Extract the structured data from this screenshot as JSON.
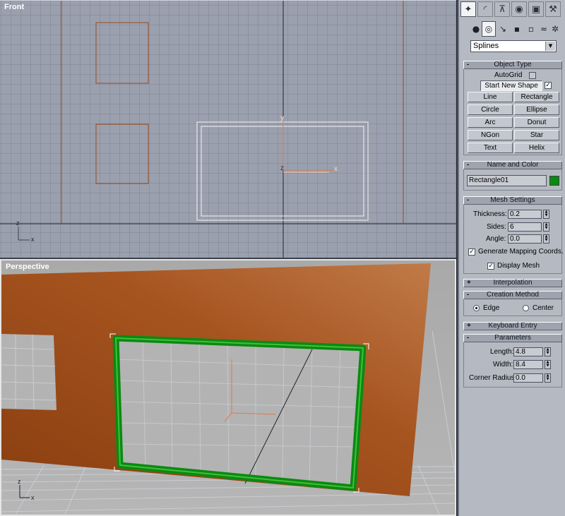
{
  "viewports": {
    "front": {
      "label": "Front"
    },
    "perspective": {
      "label": "Perspective"
    }
  },
  "panel": {
    "tabs": [
      "create-icon",
      "modify-icon",
      "hierarchy-icon",
      "motion-icon",
      "display-icon",
      "utilities-icon"
    ],
    "subcategories": [
      "geometry-icon",
      "shapes-icon",
      "lights-icon",
      "cameras-icon",
      "helpers-icon",
      "space-warps-icon",
      "systems-icon"
    ],
    "category_dropdown": "Splines",
    "object_type": {
      "title": "Object Type",
      "autogrid_label": "AutoGrid",
      "start_new_shape_label": "Start New Shape",
      "buttons": [
        "Line",
        "Rectangle",
        "Circle",
        "Ellipse",
        "Arc",
        "Donut",
        "NGon",
        "Star",
        "Text",
        "Helix"
      ]
    },
    "name_and_color": {
      "title": "Name and Color",
      "name_value": "Rectangle01",
      "color": "#0b8a10"
    },
    "mesh_settings": {
      "title": "Mesh Settings",
      "thickness_label": "Thickness:",
      "thickness_value": "0.2",
      "sides_label": "Sides:",
      "sides_value": "6",
      "angle_label": "Angle:",
      "angle_value": "0.0",
      "gen_mapping_label": "Generate Mapping Coords.",
      "display_mesh_label": "Display Mesh"
    },
    "interpolation": {
      "title": "Interpolation"
    },
    "creation_method": {
      "title": "Creation Method",
      "edge_label": "Edge",
      "center_label": "Center"
    },
    "keyboard_entry": {
      "title": "Keyboard Entry"
    },
    "parameters": {
      "title": "Parameters",
      "length_label": "Length:",
      "length_value": "4.8",
      "width_label": "Width:",
      "width_value": "8.4",
      "corner_radius_label": "Corner Radius:",
      "corner_radius_value": "0.0"
    }
  },
  "axis_labels": {
    "x": "x",
    "y": "y",
    "z": "z"
  },
  "colors": {
    "wall": "#a6541f",
    "frame": "#0b8a10",
    "viewport_bg": "#9aa0ae",
    "panel_bg": "#b5b9c2"
  }
}
